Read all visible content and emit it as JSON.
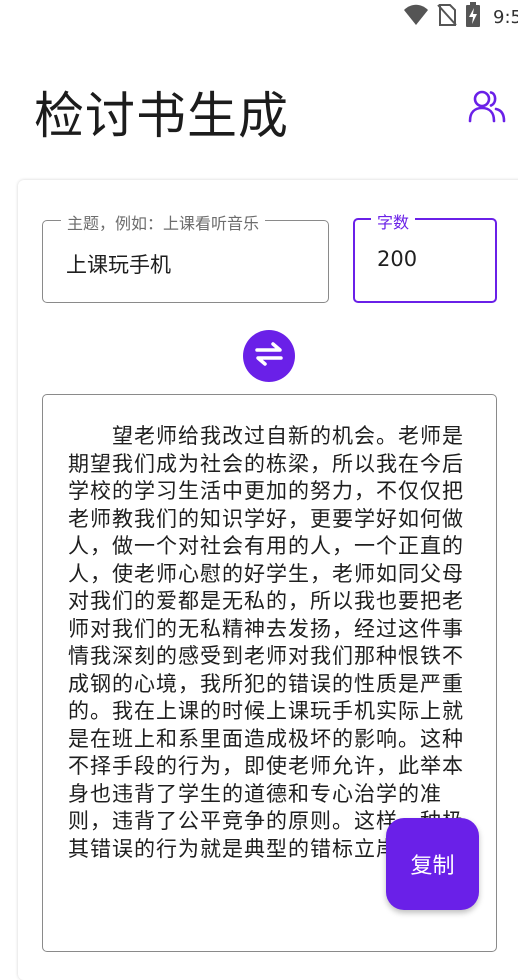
{
  "status_bar": {
    "time": "9:5",
    "icons": [
      "wifi-icon",
      "no-sim-icon",
      "battery-charging-icon"
    ]
  },
  "header": {
    "title": "检讨书生成",
    "people_icon": "people-icon"
  },
  "form": {
    "topic_label": "主题，例如：上课看听音乐",
    "topic_value": "上课玩手机",
    "count_label": "字数",
    "count_value": "200",
    "swap_icon": "swap-arrows-icon"
  },
  "result": {
    "text": "　　望老师给我改过自新的机会。老师是期望我们成为社会的栋梁，所以我在今后学校的学习生活中更加的努力，不仅仅把老师教我们的知识学好，更要学好如何做人，做一个对社会有用的人，一个正直的人，使老师心慰的好学生，老师如同父母对我们的爱都是无私的，所以我也要把老师对我们的无私精神去发扬，经过这件事情我深刻的感受到老师对我们那种恨铁不成钢的心境，我所犯的错误的性质是严重的。我在上课的时候上课玩手机实际上就是在班上和系里面造成极坏的影响。这种不择手段的行为，即使老师允许，此举本身也违背了学生的道德和专心治学的准则，违背了公平竞争的原则。这样一种极其错误的行为就是典型的错标立岸"
  },
  "copy_button": {
    "label": "复制"
  },
  "colors": {
    "accent": "#6a20e8"
  }
}
